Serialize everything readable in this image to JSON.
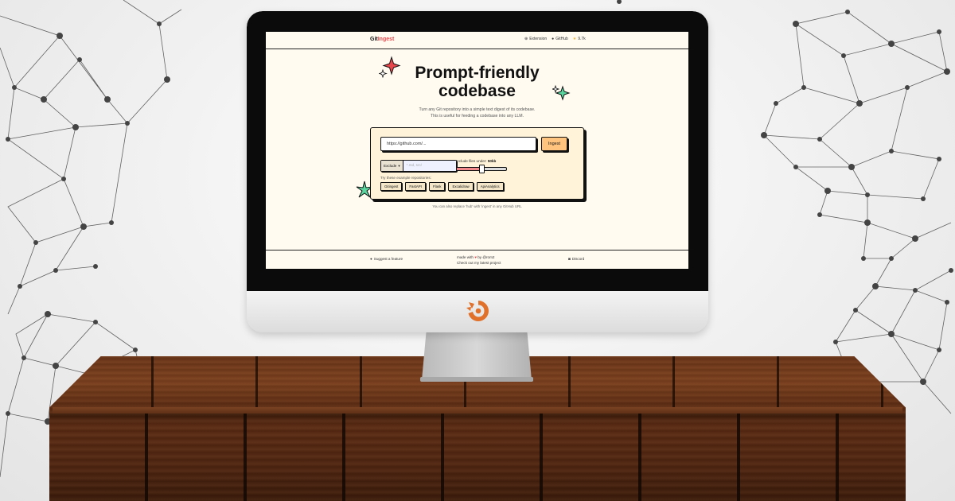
{
  "nav": {
    "brand_part1": "Git",
    "brand_part2": "Ingest",
    "extension_label": "Extension",
    "github_label": "GitHub",
    "star_count": "9.7k"
  },
  "hero": {
    "title_line1": "Prompt-friendly",
    "title_line2": "codebase",
    "subtitle_line1": "Turn any Git repository into a simple text digest of its codebase.",
    "subtitle_line2": "This is useful for feeding a codebase into any LLM."
  },
  "form": {
    "url_placeholder": "https://github.com/...",
    "ingest_label": "Ingest",
    "exclude_label": "Exclude",
    "pattern_placeholder": "*.md, src/",
    "size_label_prefix": "Include files under:",
    "size_value": "50kb",
    "size_slider_fraction": 0.5,
    "examples_label": "Try these example repositories:",
    "examples": [
      "Gitingest",
      "FastAPI",
      "Flask",
      "Excalidraw",
      "ApiAnalytics"
    ]
  },
  "hint": "You can also replace 'hub' with 'ingest' in any GitHub URL",
  "footer": {
    "suggest_label": "Suggest a feature",
    "made_with": "made with",
    "by": "by @rom2",
    "latest_project": "Check out my latest project",
    "discord_label": "Discord"
  },
  "colors": {
    "accent_red": "#e8484c",
    "page_bg": "#fffbf1",
    "card_bg": "#fff3d9",
    "button_orange": "#ffc47e",
    "logo_orange": "#e0702a"
  }
}
